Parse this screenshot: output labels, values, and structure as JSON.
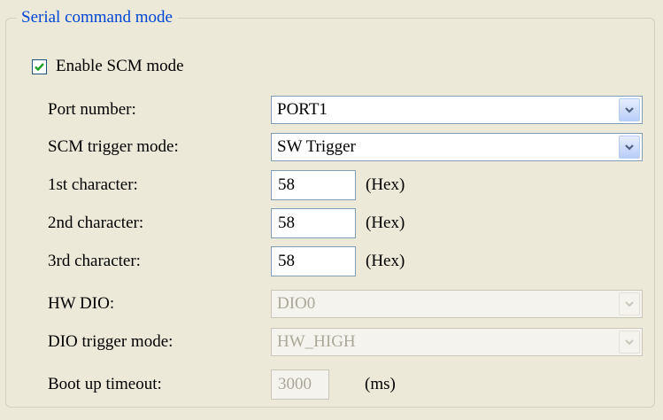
{
  "group": {
    "title": "Serial command mode"
  },
  "enable_scm": {
    "label": "Enable SCM mode",
    "checked": true
  },
  "port_number": {
    "label": "Port number:",
    "value": "PORT1"
  },
  "scm_trigger_mode": {
    "label": "SCM trigger mode:",
    "value": "SW Trigger"
  },
  "char1": {
    "label": "1st character:",
    "value": "58",
    "unit": "(Hex)"
  },
  "char2": {
    "label": "2nd character:",
    "value": "58",
    "unit": "(Hex)"
  },
  "char3": {
    "label": "3rd character:",
    "value": "58",
    "unit": "(Hex)"
  },
  "hw_dio": {
    "label": "HW DIO:",
    "value": "DIO0",
    "enabled": false
  },
  "dio_trigger_mode": {
    "label": "DIO trigger mode:",
    "value": "HW_HIGH",
    "enabled": false
  },
  "boot_timeout": {
    "label": "Boot up timeout:",
    "value": "3000",
    "unit": "(ms)",
    "enabled": false
  },
  "colors": {
    "group_title": "#0046d5",
    "disabled_text": "#aca899",
    "background": "#ece9d8"
  },
  "icons": {
    "check": "checkmark-icon",
    "dropdown": "chevron-down-icon"
  }
}
